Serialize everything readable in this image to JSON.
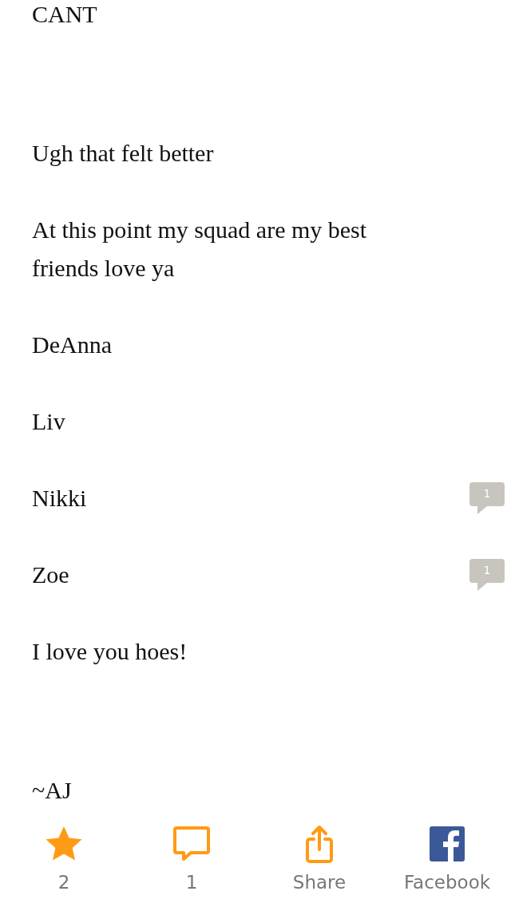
{
  "paragraphs": [
    {
      "kind": "text",
      "text": "CANT"
    },
    {
      "kind": "spacer"
    },
    {
      "kind": "text",
      "text": "Ugh that felt better"
    },
    {
      "kind": "text",
      "text": "At this point my squad are my best friends love ya"
    },
    {
      "kind": "text",
      "text": "DeAnna"
    },
    {
      "kind": "text",
      "text": "Liv"
    },
    {
      "kind": "text",
      "text": "Nikki",
      "comments": "1"
    },
    {
      "kind": "text",
      "text": "Zoe",
      "comments": "1"
    },
    {
      "kind": "text",
      "text": "I love you hoes!"
    },
    {
      "kind": "spacer"
    },
    {
      "kind": "text",
      "text": "~AJ"
    }
  ],
  "toolbar": [
    {
      "kind": "star",
      "label": "2"
    },
    {
      "kind": "comment",
      "label": "1"
    },
    {
      "kind": "share",
      "label": "Share"
    },
    {
      "kind": "facebook",
      "label": "Facebook"
    }
  ]
}
